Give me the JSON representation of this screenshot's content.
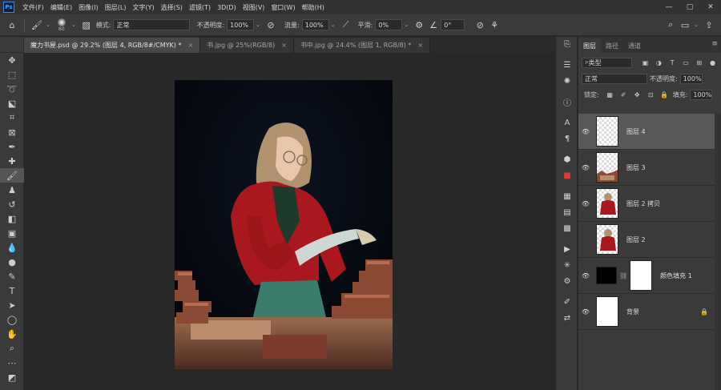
{
  "app": {
    "logo": "Ps"
  },
  "menu": [
    "文件(F)",
    "编辑(E)",
    "图像(I)",
    "图层(L)",
    "文字(Y)",
    "选择(S)",
    "滤镜(T)",
    "3D(D)",
    "视图(V)",
    "窗口(W)",
    "帮助(H)"
  ],
  "window_controls": {
    "minimize": "—",
    "maximize": "▢",
    "close": "✕"
  },
  "options_bar": {
    "brush_size": "60",
    "mode_label": "模式:",
    "mode_value": "正常",
    "opacity_label": "不透明度:",
    "opacity_value": "100%",
    "flow_label": "流量:",
    "flow_value": "100%",
    "smoothing_label": "平滑:",
    "smoothing_value": "0%",
    "angle_value": "0°"
  },
  "tabs": [
    {
      "label": "魔力书屋.psd @ 29.2% (图层 4, RGB/8#/CMYK) *",
      "active": true
    },
    {
      "label": "书.jpg @ 25%(RGB/8)",
      "active": false
    },
    {
      "label": "书中.jpg @ 24.4% (图层 1, RGB/8) *",
      "active": false
    }
  ],
  "tab_close": "×",
  "layers_panel": {
    "tabs": [
      "图层",
      "路径",
      "通道"
    ],
    "filter_label": "类型",
    "blend_mode": "正常",
    "opacity_label": "不透明度:",
    "opacity_value": "100%",
    "lock_label": "锁定:",
    "fill_label": "填充:",
    "fill_value": "100%",
    "layers": [
      {
        "name": "图层 4",
        "selected": true,
        "thumb": "empty"
      },
      {
        "name": "图层 3",
        "selected": false,
        "thumb": "books"
      },
      {
        "name": "图层 2 拷贝",
        "selected": false,
        "thumb": "woman"
      },
      {
        "name": "图层 2",
        "selected": false,
        "thumb": "woman"
      },
      {
        "name": "颜色填充 1",
        "selected": false,
        "thumb": "fill"
      },
      {
        "name": "背景",
        "selected": false,
        "thumb": "white"
      }
    ]
  },
  "colors": {
    "accent": "#31a8ff",
    "selected_layer": "#585858",
    "panel": "#3a3a3a"
  }
}
